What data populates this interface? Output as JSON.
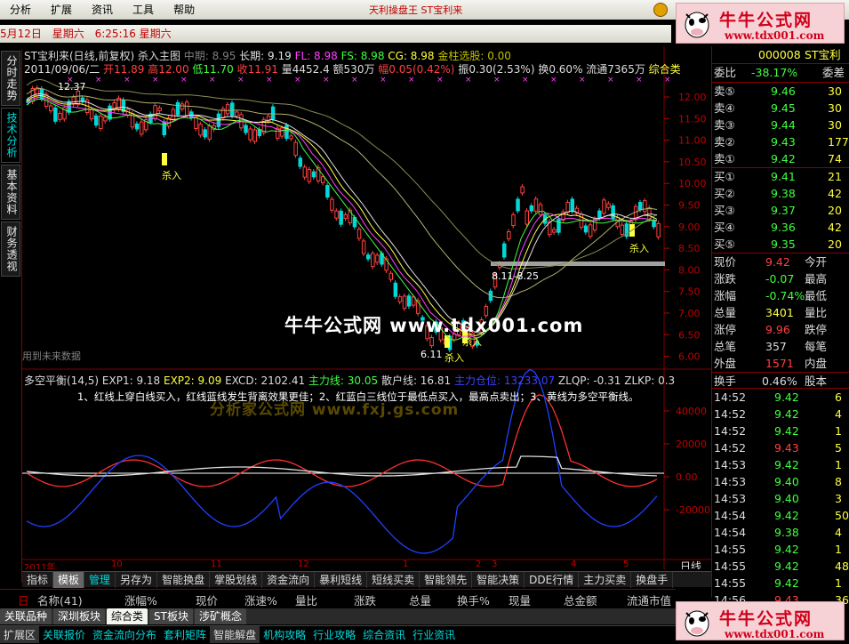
{
  "menu": {
    "items": [
      "分析",
      "扩展",
      "资讯",
      "工具",
      "帮助"
    ],
    "title": "天利操盘王 ST宝利来"
  },
  "logo": {
    "text": "牛牛公式网",
    "url": "www.tdx001.com"
  },
  "datebar": {
    "date": "5月12日",
    "weekday": "星期六",
    "time": "6:25:16 星期六"
  },
  "left_tabs": [
    "分时走势",
    "技术分析",
    "基本资料",
    "财务透视"
  ],
  "main": {
    "title": "ST宝利来(日线,前复权) 杀入主图",
    "ma": [
      {
        "label": "中期: 8.95",
        "color": "#7f7f7f"
      },
      {
        "label": "长期: 9.19",
        "color": "#e0e0e0"
      },
      {
        "label": "FL: 8.98",
        "color": "#ff40ff"
      },
      {
        "label": "FS: 8.98",
        "color": "#40ff40"
      },
      {
        "label": "CG: 8.98",
        "color": "#ffff40"
      },
      {
        "label": "金柱选股: 0.00",
        "color": "#c0c000"
      }
    ],
    "quote_date": "2011/09/06/二",
    "quote": [
      {
        "t": "开11.89",
        "c": "#ff4040"
      },
      {
        "t": "高12.00",
        "c": "#ff4040"
      },
      {
        "t": "低11.70",
        "c": "#40ff40"
      },
      {
        "t": "收11.91",
        "c": "#ff4040"
      },
      {
        "t": "量4452.4",
        "c": "#ddd"
      },
      {
        "t": "额530万",
        "c": "#ddd"
      },
      {
        "t": "幅0.05(0.42%)",
        "c": "#ff4040"
      },
      {
        "t": "振0.30(2.53%)",
        "c": "#ddd"
      },
      {
        "t": "换0.60%",
        "c": "#ddd"
      },
      {
        "t": "流通7365万",
        "c": "#ddd"
      },
      {
        "t": "综合类",
        "c": "#ffff40"
      }
    ],
    "high_label": "12.37",
    "low_label1": "6.11",
    "low_label2": "8.11-8.25",
    "sell_labels": [
      "杀入",
      "杀入",
      "杀入",
      "杀入"
    ],
    "future_note": "用到未来数据",
    "y_ticks": [
      "12.00",
      "11.50",
      "11.00",
      "10.50",
      "10.00",
      "9.50",
      "9.00",
      "8.50",
      "8.00",
      "7.50",
      "7.00",
      "6.50",
      "6.00"
    ]
  },
  "indicator": {
    "title": "多空平衡(14,5)",
    "values": [
      {
        "t": "EXP1: 9.18",
        "c": "#ddd"
      },
      {
        "t": "EXP2: 9.09",
        "c": "#ffff40"
      },
      {
        "t": "EXCD: 2102.41",
        "c": "#ddd"
      },
      {
        "t": "主力线: 30.05",
        "c": "#40ff40"
      },
      {
        "t": "散户线: 16.81",
        "c": "#ddd"
      },
      {
        "t": "主力仓位: 13233.07",
        "c": "#4040ff"
      },
      {
        "t": "ZLQP: -0.31",
        "c": "#ddd"
      },
      {
        "t": "ZLKP: 0.3",
        "c": "#ddd"
      }
    ],
    "note": "1、红线上穿白线买入，红线蓝线发生背离效果更佳；2、红蓝白三线位于最低点买入，最高点卖出；3、黄线为多空平衡线。",
    "y_ticks": [
      "40000",
      "20000",
      "0.00",
      "-20000"
    ]
  },
  "x_axis": {
    "labels": [
      "2011年",
      "10",
      "11",
      "12",
      "1",
      "2",
      "3",
      "4",
      "5"
    ],
    "period": "日线"
  },
  "watermark": {
    "main": "牛牛公式网 www.tdx001.com",
    "sub": "分析家公式网 www.fxj.gs.com"
  },
  "right": {
    "code": "000008",
    "name": "ST宝利",
    "ratio": {
      "label": "委比",
      "value": "-38.17%",
      "label2": "委差"
    },
    "sells": [
      {
        "l": "卖⑤",
        "p": "9.46",
        "v": "30"
      },
      {
        "l": "卖④",
        "p": "9.45",
        "v": "30"
      },
      {
        "l": "卖③",
        "p": "9.44",
        "v": "30"
      },
      {
        "l": "卖②",
        "p": "9.43",
        "v": "177"
      },
      {
        "l": "卖①",
        "p": "9.42",
        "v": "74"
      }
    ],
    "buys": [
      {
        "l": "买①",
        "p": "9.41",
        "v": "21"
      },
      {
        "l": "买②",
        "p": "9.38",
        "v": "42"
      },
      {
        "l": "买③",
        "p": "9.37",
        "v": "20"
      },
      {
        "l": "买④",
        "p": "9.36",
        "v": "42"
      },
      {
        "l": "买⑤",
        "p": "9.35",
        "v": "20"
      }
    ],
    "stats": [
      {
        "l": "现价",
        "v": "9.42",
        "vc": "#ff4040",
        "l2": "今开"
      },
      {
        "l": "涨跌",
        "v": "-0.07",
        "vc": "#40ff40",
        "l2": "最高"
      },
      {
        "l": "涨幅",
        "v": "-0.74%",
        "vc": "#40ff40",
        "l2": "最低"
      },
      {
        "l": "总量",
        "v": "3401",
        "vc": "#ffff40",
        "l2": "量比"
      },
      {
        "l": "涨停",
        "v": "9.96",
        "vc": "#ff4040",
        "l2": "跌停"
      },
      {
        "l": "总笔",
        "v": "357",
        "vc": "#ddd",
        "l2": "每笔"
      },
      {
        "l": "外盘",
        "v": "1571",
        "vc": "#ff4040",
        "l2": "内盘"
      }
    ],
    "turnover": {
      "l": "换手",
      "v": "0.46%",
      "l2": "股本"
    },
    "ticks": [
      {
        "t": "14:52",
        "p": "9.42",
        "v": "6"
      },
      {
        "t": "14:52",
        "p": "9.42",
        "v": "4"
      },
      {
        "t": "14:52",
        "p": "9.42",
        "v": "1"
      },
      {
        "t": "14:52",
        "p": "9.43",
        "v": "5"
      },
      {
        "t": "14:53",
        "p": "9.42",
        "v": "1"
      },
      {
        "t": "14:53",
        "p": "9.40",
        "v": "8"
      },
      {
        "t": "14:53",
        "p": "9.40",
        "v": "3"
      },
      {
        "t": "14:54",
        "p": "9.42",
        "v": "50"
      },
      {
        "t": "14:54",
        "p": "9.38",
        "v": "4"
      },
      {
        "t": "14:55",
        "p": "9.42",
        "v": "1"
      },
      {
        "t": "14:55",
        "p": "9.42",
        "v": "48"
      },
      {
        "t": "14:55",
        "p": "9.42",
        "v": "1"
      },
      {
        "t": "14:56",
        "p": "9.43",
        "v": "36"
      }
    ]
  },
  "bottom_tabs": [
    "指标",
    "模板",
    "管理",
    "另存为",
    "智能换盘",
    "掌股划线",
    "资金流向",
    "暴利短线",
    "短线买卖",
    "智能领先",
    "智能决策",
    "DDE行情",
    "主力买卖",
    "换盘手"
  ],
  "columns": [
    "名称(41)",
    "涨幅%",
    "现价",
    "涨速%",
    "量比",
    "涨跌",
    "总量",
    "换手%",
    "现量",
    "总金额",
    "流通市值"
  ],
  "sheet_tabs": [
    "关联品种",
    "深圳板块",
    "综合类",
    "ST板块",
    "涉矿概念"
  ],
  "status": [
    "扩展区",
    "关联报价",
    "资金流向分布",
    "套利矩阵",
    "智能解盘",
    "机构攻略",
    "行业攻略",
    "综合资讯",
    "行业资讯"
  ]
}
